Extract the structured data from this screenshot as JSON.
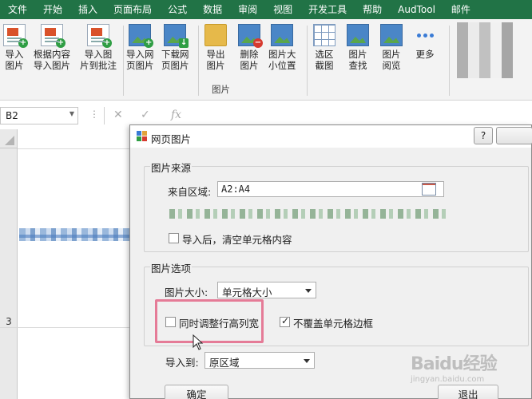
{
  "ribbon_tabs": [
    "文件",
    "开始",
    "插入",
    "页面布局",
    "公式",
    "数据",
    "审阅",
    "视图",
    "开发工具",
    "帮助",
    "AudTool",
    "邮件"
  ],
  "ribbon_buttons": [
    {
      "label": "导入\n图片",
      "icon": "import-image-icon"
    },
    {
      "label": "根据内容\n导入图片",
      "icon": "import-by-content-icon"
    },
    {
      "label": "导入图\n片到批注",
      "icon": "import-to-comment-icon"
    },
    {
      "label": "导入网\n页图片",
      "icon": "import-web-image-icon"
    },
    {
      "label": "下载网\n页图片",
      "icon": "download-web-image-icon"
    },
    {
      "label": "导出\n图片",
      "icon": "export-image-icon"
    },
    {
      "label": "删除\n图片",
      "icon": "delete-image-icon"
    },
    {
      "label": "图片大\n小位置",
      "icon": "image-size-position-icon"
    },
    {
      "label": "选区\n截图",
      "icon": "selection-screenshot-icon"
    },
    {
      "label": "图片\n查找",
      "icon": "image-find-icon"
    },
    {
      "label": "图片\n阅览",
      "icon": "image-preview-icon"
    },
    {
      "label": "更多",
      "icon": "more-icon"
    }
  ],
  "ribbon_group_label": "图片",
  "formula_bar": {
    "name_box": "B2",
    "fx": "fx"
  },
  "sheet": {
    "row_label_3": "3"
  },
  "dialog": {
    "title": "网页图片",
    "help_label": "?",
    "source_group": {
      "title": "图片来源",
      "range_label": "来自区域:",
      "range_value": "A2:A4",
      "clear_checkbox_label": "导入后，清空单元格内容",
      "clear_checked": false
    },
    "options_group": {
      "title": "图片选项",
      "size_label": "图片大小:",
      "size_value": "单元格大小",
      "adjust_checkbox_label": "同时调整行高列宽",
      "adjust_checked": false,
      "border_checkbox_label": "不覆盖单元格边框",
      "border_checked": true
    },
    "import_to_label": "导入到:",
    "import_to_value": "原区域",
    "ok_label": "确定",
    "exit_label": "退出"
  },
  "watermark": {
    "main": "Baidu经验",
    "sub": "jingyan.baidu.com"
  }
}
